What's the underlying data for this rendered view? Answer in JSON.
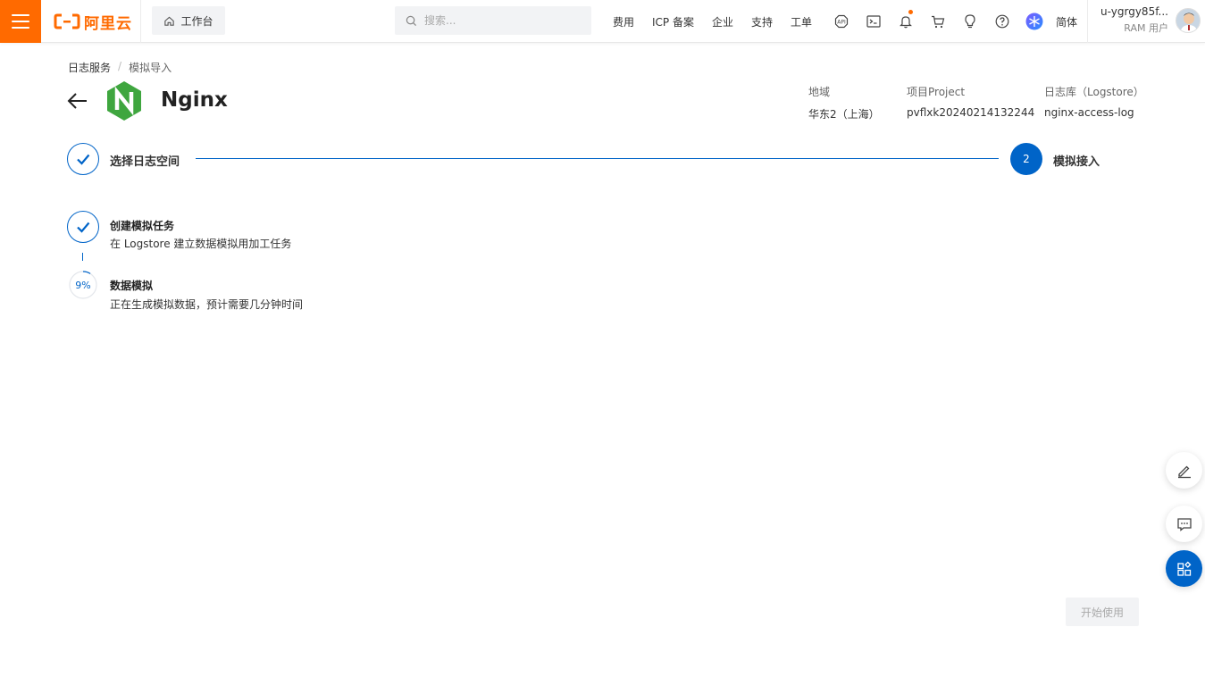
{
  "topbar": {
    "logo_text": "阿里云",
    "workbench_label": "工作台",
    "search_placeholder": "搜索...",
    "nav_links": [
      "费用",
      "ICP 备案",
      "企业",
      "支持",
      "工单"
    ],
    "icons": [
      "api-icon",
      "terminal-icon",
      "bell-icon",
      "cart-icon",
      "lightbulb-icon",
      "help-icon",
      "ai-assistant-icon"
    ],
    "lang": "简体",
    "user_name": "u-ygrgy85f...",
    "user_role": "RAM 用户",
    "brand_color": "#ff6a00"
  },
  "breadcrumb": {
    "root": "日志服务",
    "separator": "/",
    "current": "模拟导入"
  },
  "header": {
    "title": "Nginx",
    "meta": [
      {
        "label": "地域",
        "value": "华东2（上海）"
      },
      {
        "label": "项目Project",
        "value": "pvflxk20240214132244"
      },
      {
        "label": "日志库（Logstore）",
        "value": "nginx-access-log"
      }
    ]
  },
  "steps": {
    "step1_label": "选择日志空间",
    "step2_number": "2",
    "step2_label": "模拟接入",
    "accent_color": "#0064c8"
  },
  "sub_steps": {
    "task1_title": "创建模拟任务",
    "task1_desc": "在 Logstore 建立数据模拟用加工任务",
    "task2_progress": 9,
    "task2_progress_text": "9%",
    "task2_title": "数据模拟",
    "task2_desc": "正在生成模拟数据，预计需要几分钟时间"
  },
  "actions": {
    "start_button": "开始使用"
  },
  "float_icons": [
    "edit-icon",
    "feedback-icon",
    "apps-icon"
  ]
}
